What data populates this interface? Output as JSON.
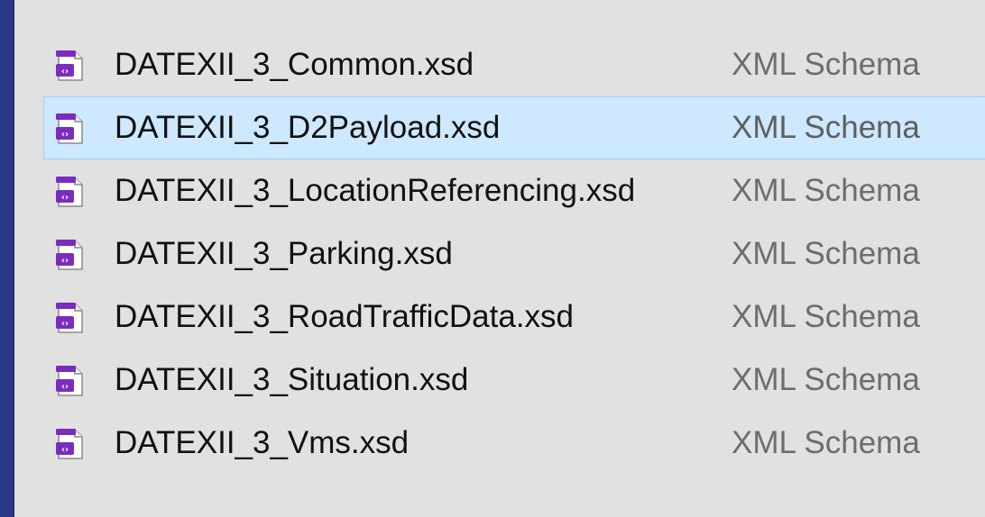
{
  "files": [
    {
      "name": "DATEXII_3_Common.xsd",
      "type": "XML Schema",
      "icon": "xml-schema-file-icon",
      "selected": false
    },
    {
      "name": "DATEXII_3_D2Payload.xsd",
      "type": "XML Schema",
      "icon": "xml-schema-file-icon",
      "selected": true
    },
    {
      "name": "DATEXII_3_LocationReferencing.xsd",
      "type": "XML Schema",
      "icon": "xml-schema-file-icon",
      "selected": false
    },
    {
      "name": "DATEXII_3_Parking.xsd",
      "type": "XML Schema",
      "icon": "xml-schema-file-icon",
      "selected": false
    },
    {
      "name": "DATEXII_3_RoadTrafficData.xsd",
      "type": "XML Schema",
      "icon": "xml-schema-file-icon",
      "selected": false
    },
    {
      "name": "DATEXII_3_Situation.xsd",
      "type": "XML Schema",
      "icon": "xml-schema-file-icon",
      "selected": false
    },
    {
      "name": "DATEXII_3_Vms.xsd",
      "type": "XML Schema",
      "icon": "xml-schema-file-icon",
      "selected": false
    }
  ],
  "colors": {
    "selection_background": "#cde8ff",
    "selection_border": "#99d1ff",
    "panel_background": "#e1e1e1",
    "window_frame": "#2a3686",
    "icon_purple": "#7b2cbf"
  }
}
